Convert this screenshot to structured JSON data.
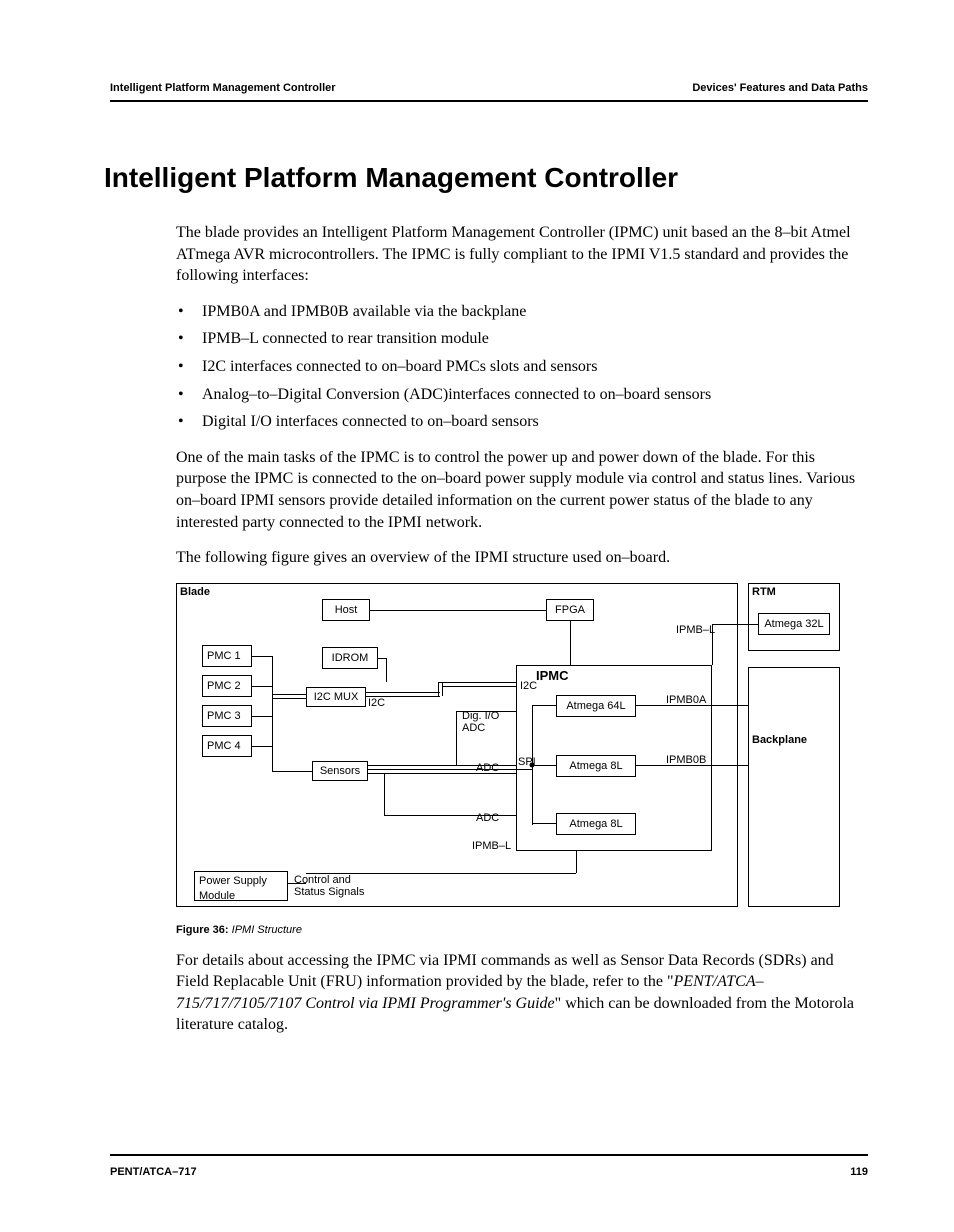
{
  "header": {
    "left": "Intelligent Platform Management Controller",
    "right": "Devices' Features and Data Paths"
  },
  "title": "Intelligent Platform Management Controller",
  "intro": "The blade provides an Intelligent Platform Management Controller (IPMC) unit based an the 8–bit Atmel ATmega AVR microcontrollers. The IPMC is fully compliant to the IPMI V1.5 standard and provides the following interfaces:",
  "bullets": [
    "IPMB0A and IPMB0B available via the backplane",
    "IPMB–L connected to rear transition module",
    "I2C interfaces connected to on–board PMCs slots and sensors",
    "Analog–to–Digital Conversion (ADC)interfaces connected to on–board sensors",
    "Digital I/O interfaces connected to on–board sensors"
  ],
  "para2": "One of the main tasks of the IPMC is to control the power up and power down of the blade. For this purpose the IPMC is connected to the on–board power supply module via control and status lines. Various on–board IPMI sensors provide detailed information on the current power status of the blade to any interested party connected to the IPMI network.",
  "para3": "The following figure gives an overview of the IPMI structure used on–board.",
  "diagram": {
    "blade": "Blade",
    "rtm": "RTM",
    "backplane": "Backplane",
    "host": "Host",
    "fpga": "FPGA",
    "idrom": "IDROM",
    "ipmc": "IPMC",
    "pmc1": "PMC 1",
    "pmc2": "PMC 2",
    "pmc3": "PMC 3",
    "pmc4": "PMC 4",
    "i2cmux": "I2C MUX",
    "sensors": "Sensors",
    "atmega64l": "Atmega 64L",
    "atmega8l_a": "Atmega 8L",
    "atmega8l_b": "Atmega 8L",
    "atmega32l": "Atmega 32L",
    "psm1": "Power Supply",
    "psm2": "Module",
    "ctrl1": "Control and",
    "ctrl2": "Status Signals",
    "i2c": "I2C",
    "i2c2": "I2C",
    "digio": "Dig. I/O",
    "adc_label": "ADC",
    "adc1": "ADC",
    "adc2": "ADC",
    "spi": "SPI",
    "ipmbl": "IPMB–L",
    "ipmbl2": "IPMB–L",
    "ipmb0a": "IPMB0A",
    "ipmb0b": "IPMB0B"
  },
  "figcap_bold": "Figure 36:",
  "figcap_italic": " IPMI Structure",
  "closing_a": "For details about accessing the IPMC via IPMI commands as well as Sensor Data Records (SDRs) and Field Replacable Unit (FRU) information provided by the blade, refer to the \"",
  "closing_i": "PENT/ATCA–715/717/7105/7107 Control via IPMI Programmer's Guide",
  "closing_b": "\" which can be downloaded from the Motorola literature catalog.",
  "footer": {
    "left": "PENT/ATCA–717",
    "right": "119"
  }
}
